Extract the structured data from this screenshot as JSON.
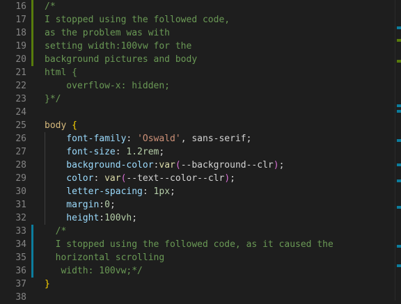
{
  "lines": [
    {
      "num": "16",
      "change": "mod",
      "text": "/*"
    },
    {
      "num": "17",
      "change": "mod",
      "text": "I stopped using the followed code,"
    },
    {
      "num": "18",
      "change": "mod",
      "text": "as the problem was with"
    },
    {
      "num": "19",
      "change": "mod",
      "text": "setting width:100vw for the"
    },
    {
      "num": "20",
      "change": "mod",
      "text": "background pictures and body"
    },
    {
      "num": "21",
      "change": "",
      "text": "html {"
    },
    {
      "num": "22",
      "change": "",
      "text": "    overflow-x: hidden;"
    },
    {
      "num": "23",
      "change": "",
      "text": "}*/"
    },
    {
      "num": "24",
      "change": "",
      "text": ""
    },
    {
      "num": "25",
      "change": "",
      "text": "body {"
    },
    {
      "num": "26",
      "change": "",
      "text": "    font-family: 'Oswald', sans-serif;"
    },
    {
      "num": "27",
      "change": "",
      "text": "    font-size: 1.2rem;"
    },
    {
      "num": "28",
      "change": "",
      "text": "    background-color:var(--background--clr);"
    },
    {
      "num": "29",
      "change": "",
      "text": "    color: var(--text--color--clr);"
    },
    {
      "num": "30",
      "change": "",
      "text": "    letter-spacing: 1px;"
    },
    {
      "num": "31",
      "change": "",
      "text": "    margin:0;"
    },
    {
      "num": "32",
      "change": "",
      "text": "    height:100vh;"
    },
    {
      "num": "33",
      "change": "add",
      "text": "  /*"
    },
    {
      "num": "34",
      "change": "add",
      "text": "  I stopped using the followed code, as it caused the"
    },
    {
      "num": "35",
      "change": "add",
      "text": "  horizontal scrolling"
    },
    {
      "num": "36",
      "change": "add",
      "text": "   width: 100vw;*/"
    },
    {
      "num": "37",
      "change": "",
      "text": "}"
    },
    {
      "num": "38",
      "change": "",
      "text": ""
    }
  ],
  "colors": {
    "modified_gutter": "#587c0c",
    "added_gutter": "#0c7d9d",
    "comment": "#6a9955",
    "selector": "#d7ba7d",
    "property": "#9cdcfe",
    "string": "#ce9178",
    "number": "#b5cea8",
    "brace": "#ffd700"
  }
}
